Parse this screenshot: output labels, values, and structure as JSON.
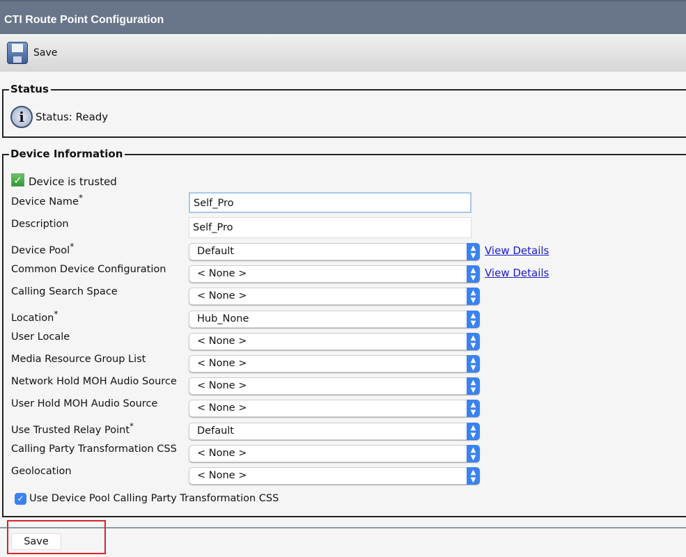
{
  "title": "CTI Route Point Configuration",
  "toolbar": {
    "save_label": "Save"
  },
  "status": {
    "legend": "Status",
    "text": "Status: Ready"
  },
  "device": {
    "legend": "Device Information",
    "trusted": "Device is trusted",
    "name_label": "Device Name",
    "name_value": "Self_Pro",
    "desc_label": "Description",
    "desc_value": "Self_Pro",
    "required": "*",
    "view_details": "View Details",
    "selects": [
      {
        "label": "Device Pool",
        "value": "Default"
      },
      {
        "label": "Common Device Configuration",
        "value": "< None >"
      },
      {
        "label": "Calling Search Space",
        "value": "< None >"
      },
      {
        "label": "Location",
        "value": "Hub_None"
      },
      {
        "label": "User Locale",
        "value": "< None >"
      },
      {
        "label": "Media Resource Group List",
        "value": "< None >"
      },
      {
        "label": "Network Hold MOH Audio Source",
        "value": "< None >"
      },
      {
        "label": "User Hold MOH Audio Source",
        "value": "< None >"
      },
      {
        "label": "Use Trusted Relay Point",
        "value": "Default"
      },
      {
        "label": "Calling Party Transformation CSS",
        "value": "< None >"
      },
      {
        "label": "Geolocation",
        "value": "< None >"
      }
    ],
    "use_pool_css": "Use Device Pool Calling Party Transformation CSS"
  },
  "bottom": {
    "save_label": "Save"
  }
}
